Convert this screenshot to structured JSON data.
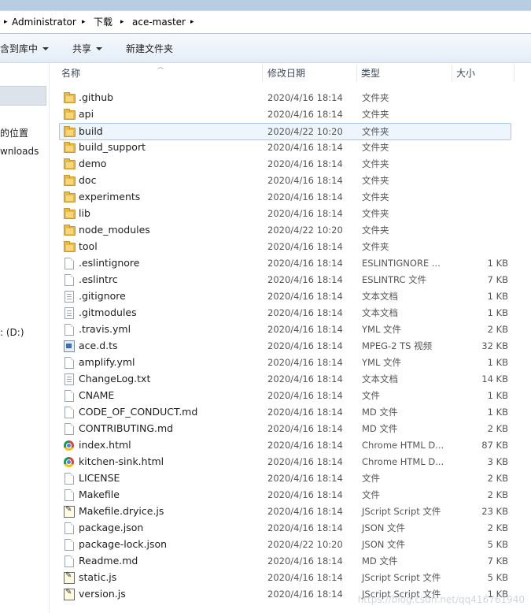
{
  "breadcrumb": [
    "Administrator",
    "下载",
    "ace-master"
  ],
  "toolbar": {
    "include_in_library": "含到库中",
    "share": "共享",
    "new_folder": "新建文件夹"
  },
  "nav": {
    "items": [
      "的位置",
      "wnloads",
      ": (D:)"
    ]
  },
  "columns": {
    "name": "名称",
    "date": "修改日期",
    "type": "类型",
    "size": "大小"
  },
  "files": [
    {
      "name": ".github",
      "date": "2020/4/16 18:14",
      "type": "文件夹",
      "size": "",
      "icon": "folder"
    },
    {
      "name": "api",
      "date": "2020/4/16 18:14",
      "type": "文件夹",
      "size": "",
      "icon": "folder"
    },
    {
      "name": "build",
      "date": "2020/4/22 10:20",
      "type": "文件夹",
      "size": "",
      "icon": "folder",
      "selected": true
    },
    {
      "name": "build_support",
      "date": "2020/4/16 18:14",
      "type": "文件夹",
      "size": "",
      "icon": "folder"
    },
    {
      "name": "demo",
      "date": "2020/4/16 18:14",
      "type": "文件夹",
      "size": "",
      "icon": "folder"
    },
    {
      "name": "doc",
      "date": "2020/4/16 18:14",
      "type": "文件夹",
      "size": "",
      "icon": "folder"
    },
    {
      "name": "experiments",
      "date": "2020/4/16 18:14",
      "type": "文件夹",
      "size": "",
      "icon": "folder"
    },
    {
      "name": "lib",
      "date": "2020/4/16 18:14",
      "type": "文件夹",
      "size": "",
      "icon": "folder"
    },
    {
      "name": "node_modules",
      "date": "2020/4/22 10:20",
      "type": "文件夹",
      "size": "",
      "icon": "folder"
    },
    {
      "name": "tool",
      "date": "2020/4/16 18:14",
      "type": "文件夹",
      "size": "",
      "icon": "folder"
    },
    {
      "name": ".eslintignore",
      "date": "2020/4/16 18:14",
      "type": "ESLINTIGNORE ...",
      "size": "1 KB",
      "icon": "file"
    },
    {
      "name": ".eslintrc",
      "date": "2020/4/16 18:14",
      "type": "ESLINTRC 文件",
      "size": "7 KB",
      "icon": "file"
    },
    {
      "name": ".gitignore",
      "date": "2020/4/16 18:14",
      "type": "文本文档",
      "size": "1 KB",
      "icon": "text"
    },
    {
      "name": ".gitmodules",
      "date": "2020/4/16 18:14",
      "type": "文本文档",
      "size": "1 KB",
      "icon": "text"
    },
    {
      "name": ".travis.yml",
      "date": "2020/4/16 18:14",
      "type": "YML 文件",
      "size": "2 KB",
      "icon": "file"
    },
    {
      "name": "ace.d.ts",
      "date": "2020/4/16 18:14",
      "type": "MPEG-2 TS 视频",
      "size": "32 KB",
      "icon": "ts"
    },
    {
      "name": "amplify.yml",
      "date": "2020/4/16 18:14",
      "type": "YML 文件",
      "size": "1 KB",
      "icon": "file"
    },
    {
      "name": "ChangeLog.txt",
      "date": "2020/4/16 18:14",
      "type": "文本文档",
      "size": "14 KB",
      "icon": "text"
    },
    {
      "name": "CNAME",
      "date": "2020/4/16 18:14",
      "type": "文件",
      "size": "1 KB",
      "icon": "file"
    },
    {
      "name": "CODE_OF_CONDUCT.md",
      "date": "2020/4/16 18:14",
      "type": "MD 文件",
      "size": "1 KB",
      "icon": "file"
    },
    {
      "name": "CONTRIBUTING.md",
      "date": "2020/4/16 18:14",
      "type": "MD 文件",
      "size": "2 KB",
      "icon": "file"
    },
    {
      "name": "index.html",
      "date": "2020/4/16 18:14",
      "type": "Chrome HTML D...",
      "size": "87 KB",
      "icon": "chrome"
    },
    {
      "name": "kitchen-sink.html",
      "date": "2020/4/16 18:14",
      "type": "Chrome HTML D...",
      "size": "3 KB",
      "icon": "chrome"
    },
    {
      "name": "LICENSE",
      "date": "2020/4/16 18:14",
      "type": "文件",
      "size": "2 KB",
      "icon": "file"
    },
    {
      "name": "Makefile",
      "date": "2020/4/16 18:14",
      "type": "文件",
      "size": "2 KB",
      "icon": "file"
    },
    {
      "name": "Makefile.dryice.js",
      "date": "2020/4/16 18:14",
      "type": "JScript Script 文件",
      "size": "23 KB",
      "icon": "js"
    },
    {
      "name": "package.json",
      "date": "2020/4/16 18:14",
      "type": "JSON 文件",
      "size": "2 KB",
      "icon": "file"
    },
    {
      "name": "package-lock.json",
      "date": "2020/4/22 10:20",
      "type": "JSON 文件",
      "size": "5 KB",
      "icon": "file"
    },
    {
      "name": "Readme.md",
      "date": "2020/4/16 18:14",
      "type": "MD 文件",
      "size": "7 KB",
      "icon": "file"
    },
    {
      "name": "static.js",
      "date": "2020/4/16 18:14",
      "type": "JScript Script 文件",
      "size": "5 KB",
      "icon": "js"
    },
    {
      "name": "version.js",
      "date": "2020/4/16 18:14",
      "type": "JScript Script 文件",
      "size": "1 KB",
      "icon": "js"
    }
  ],
  "watermark": "https://blog.csdn.net/qq416761940"
}
